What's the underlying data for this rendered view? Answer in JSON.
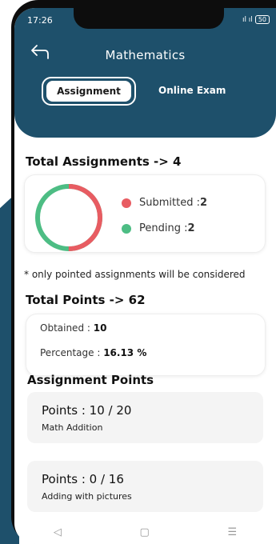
{
  "status_bar": {
    "time": "17:26",
    "signal": "ıl ıl",
    "battery": "50"
  },
  "header": {
    "title": "Mathematics"
  },
  "tabs": [
    {
      "label": "Assignment",
      "active": true
    },
    {
      "label": "Online Exam",
      "active": false
    }
  ],
  "summary": {
    "total_label": "Total Assignments -> 4",
    "submitted_label": "Submitted : ",
    "submitted_value": "2",
    "pending_label": "Pending : ",
    "pending_value": "2",
    "submitted_count": 2,
    "pending_count": 2
  },
  "note": "* only pointed assignments will be considered",
  "points": {
    "total_label": "Total Points -> 62",
    "obtained_label": "Obtained : ",
    "obtained_value": "10",
    "percentage_label": "Percentage : ",
    "percentage_value": "16.13 %"
  },
  "assignment_points": {
    "title": "Assignment Points",
    "items": [
      {
        "points": "Points : 10 / 20",
        "name": "Math Addition"
      },
      {
        "points": "Points : 0 / 16",
        "name": "Adding with pictures"
      }
    ]
  },
  "colors": {
    "primary": "#1e506b",
    "submitted": "#e85c62",
    "pending": "#4dbd84"
  },
  "nav": {
    "back": "◁",
    "home": "▢",
    "menu": "☰"
  }
}
